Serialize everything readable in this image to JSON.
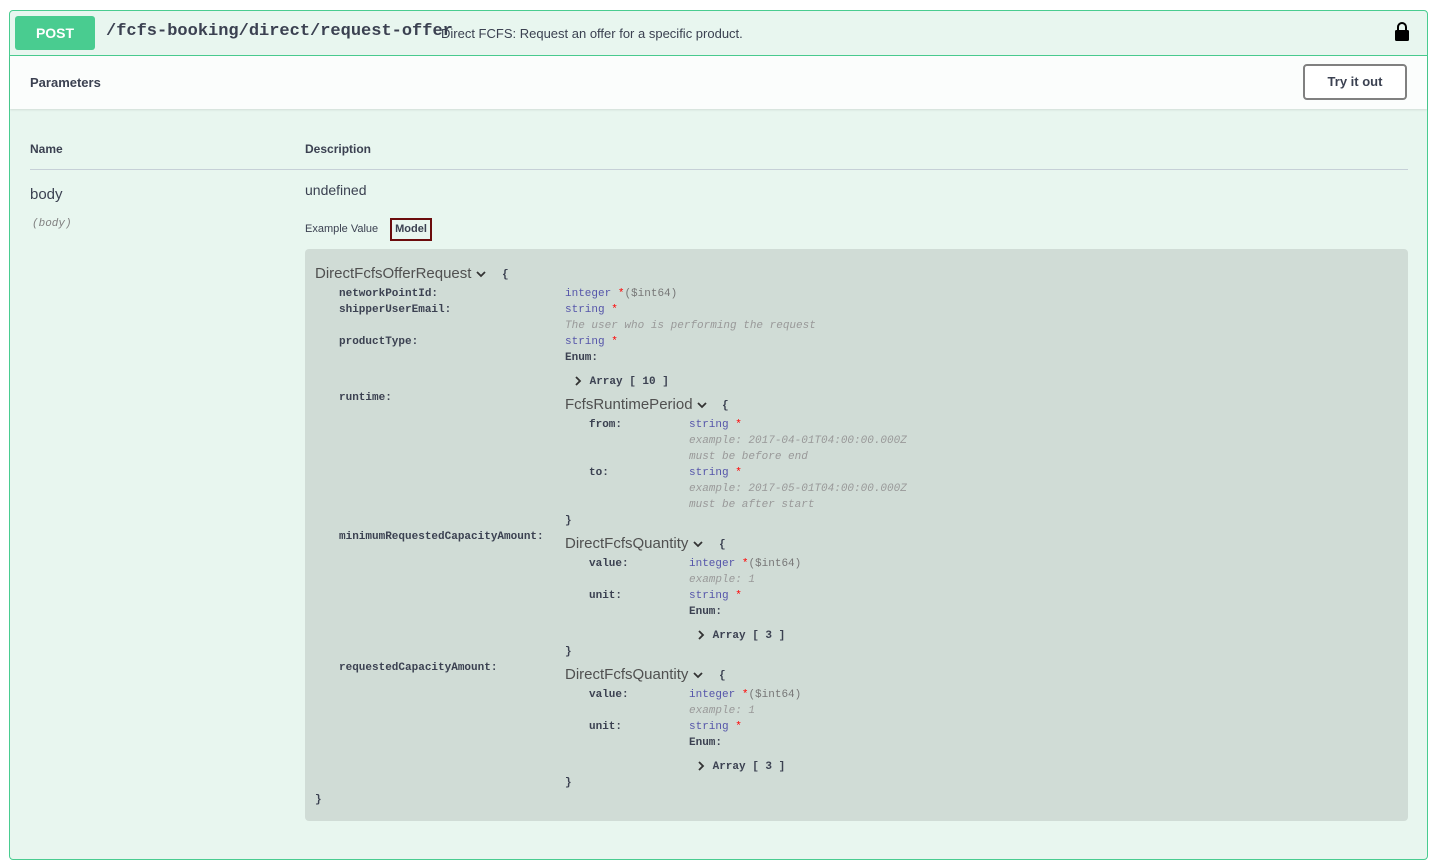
{
  "operation": {
    "method": "POST",
    "path": "/fcfs-booking/direct/request-offer",
    "summary": "Direct FCFS: Request an offer for a specific product."
  },
  "parameters": {
    "title": "Parameters",
    "try_label": "Try it out",
    "col_name": "Name",
    "col_desc": "Description",
    "param_name": "body",
    "param_in": "(body)",
    "param_desc": "undefined",
    "tab_example": "Example Value",
    "tab_model": "Model"
  },
  "model": {
    "name": "DirectFcfsOfferRequest",
    "open": "{",
    "close": "}",
    "fields": {
      "networkPointId": {
        "label": "networkPointId:",
        "type": "integer",
        "req": "*",
        "fmt": "($int64)"
      },
      "shipperUserEmail": {
        "label": "shipperUserEmail:",
        "type": "string",
        "req": "*",
        "desc": "The user who is performing the request"
      },
      "productType": {
        "label": "productType:",
        "type": "string",
        "req": "*",
        "enum": "Enum:",
        "array": "Array [ 10 ]"
      },
      "runtime": {
        "label": "runtime:",
        "model": "FcfsRuntimePeriod",
        "open": "{",
        "close": "}",
        "from": {
          "label": "from:",
          "type": "string",
          "req": "*",
          "example": "example: 2017-04-01T04:00:00.000Z",
          "desc": "must be before end"
        },
        "to": {
          "label": "to:",
          "type": "string",
          "req": "*",
          "example": "example: 2017-05-01T04:00:00.000Z",
          "desc": "must be after start"
        }
      },
      "minimumRequestedCapacityAmount": {
        "label": "minimumRequestedCapacityAmount:",
        "model": "DirectFcfsQuantity",
        "open": "{",
        "close": "}",
        "value": {
          "label": "value:",
          "type": "integer",
          "req": "*",
          "fmt": "($int64)",
          "example": "example: 1"
        },
        "unit": {
          "label": "unit:",
          "type": "string",
          "req": "*",
          "enum": "Enum:",
          "array": "Array [ 3 ]"
        }
      },
      "requestedCapacityAmount": {
        "label": "requestedCapacityAmount:",
        "model": "DirectFcfsQuantity",
        "open": "{",
        "close": "}",
        "value": {
          "label": "value:",
          "type": "integer",
          "req": "*",
          "fmt": "($int64)",
          "example": "example: 1"
        },
        "unit": {
          "label": "unit:",
          "type": "string",
          "req": "*",
          "enum": "Enum:",
          "array": "Array [ 3 ]"
        }
      }
    }
  },
  "colors": {
    "method_bg": "#49cc90",
    "block_bg": "#e8f6ef",
    "model_bg": "#d0dcd6",
    "type_color": "#5555aa",
    "required_color": "#ff0000"
  },
  "icons": [
    "lock-icon",
    "chevron-down-icon",
    "chevron-right-icon"
  ]
}
